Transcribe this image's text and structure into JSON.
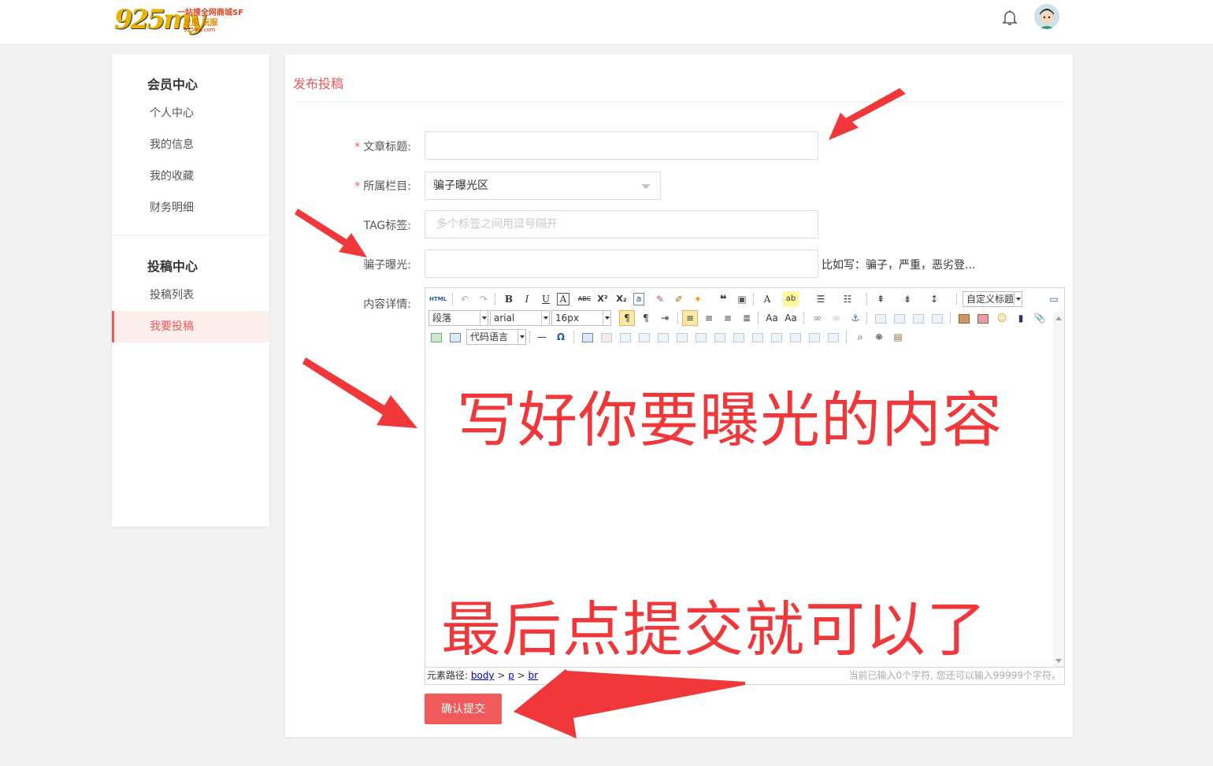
{
  "header": {
    "logo_big": "925my",
    "logo_line1": "一站搜全网商城SF",
    "logo_line2": "发服 玩服",
    "logo_line3": "925my.com"
  },
  "sidebar": {
    "groups": [
      {
        "title": "会员中心",
        "items": [
          "个人中心",
          "我的信息",
          "我的收藏",
          "财务明细"
        ]
      },
      {
        "title": "投稿中心",
        "items": [
          "投稿列表",
          "我要投稿"
        ]
      }
    ],
    "active_item": "我要投稿"
  },
  "panel": {
    "title": "发布投稿",
    "fields": {
      "title_label": "文章标题:",
      "title_value": "",
      "column_label": "所属栏目:",
      "column_value": "骗子曝光区",
      "tag_label": "TAG标签:",
      "tag_placeholder": "多个标签之间用逗号隔开",
      "scam_label": "骗子曝光:",
      "scam_value": "",
      "scam_hint": "比如写：骗子，严重，恶劣登...",
      "content_label": "内容详情:"
    },
    "required_mark": "*",
    "submit_label": "确认提交"
  },
  "editor": {
    "row1": [
      "HTML",
      "B",
      "I",
      "U",
      "A",
      "ABC",
      "X²",
      "X₂",
      "a",
      "A",
      "ab",
      "自定义标题"
    ],
    "custom_title": "自定义标题",
    "paragraph_select": "段落",
    "font_select": "arial",
    "size_select": "16px",
    "code_lang_select": "代码语言",
    "status_path_label": "元素路径: ",
    "status_path": [
      "body",
      "p",
      "br"
    ],
    "status_count": "当前已输入0个字符, 您还可以输入99999个字符。"
  },
  "annotations": {
    "text1": "写好你要曝光的内容",
    "text2": "最后点提交就可以了",
    "color": "#f0373a"
  },
  "colors": {
    "accent": "#f05a5a",
    "active_bg": "#fdeeee"
  }
}
